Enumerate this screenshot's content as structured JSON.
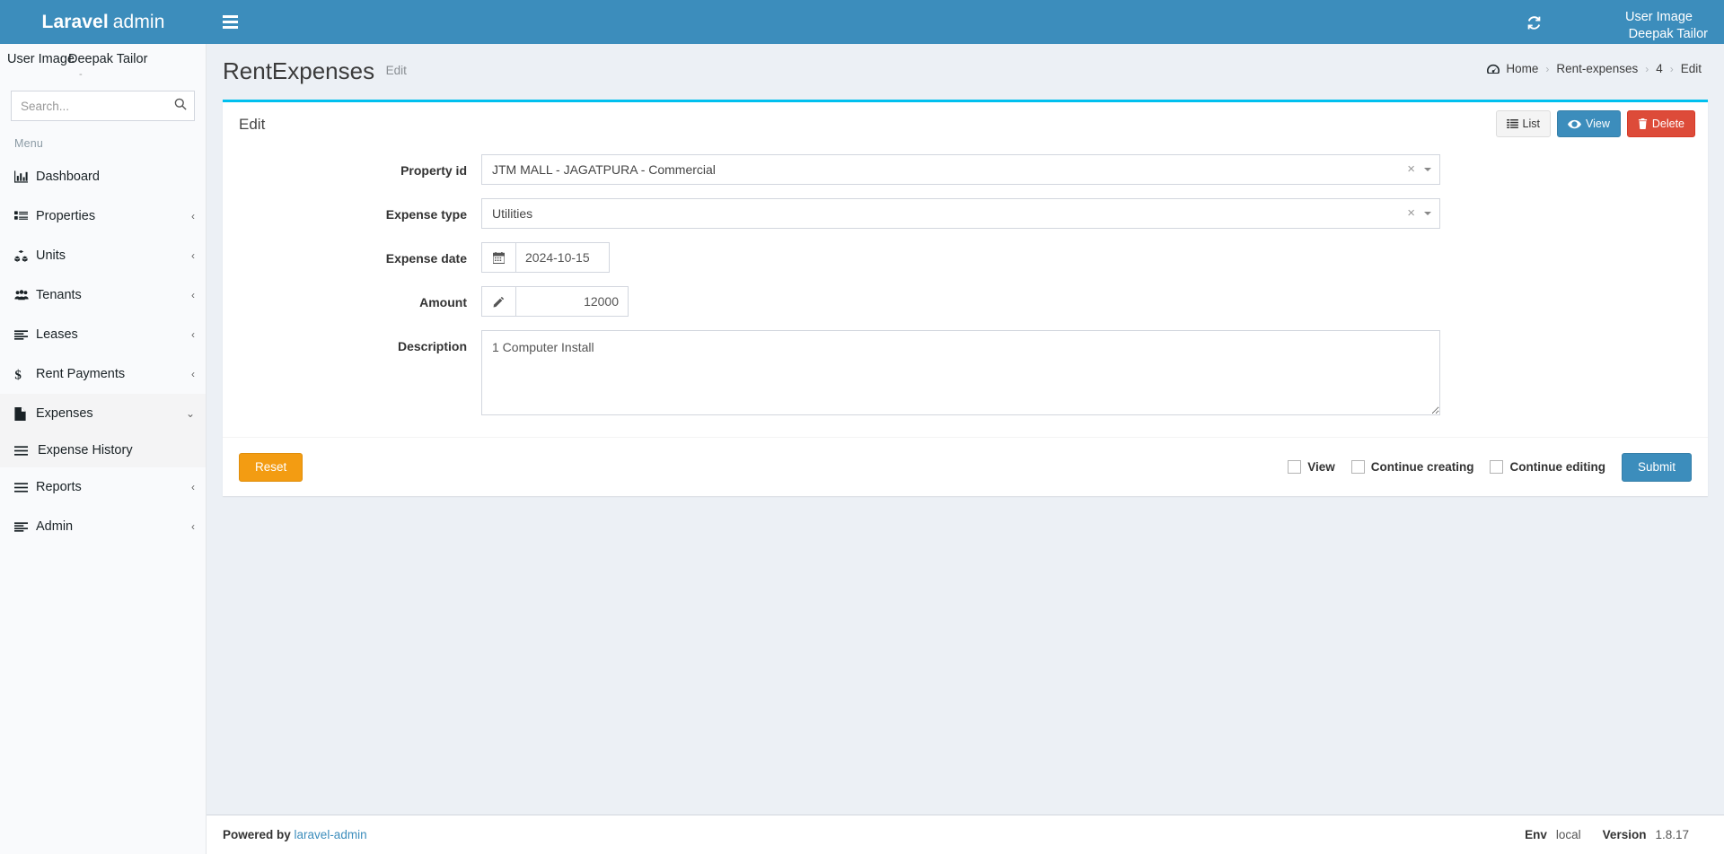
{
  "navbar": {
    "brand_bold": "Laravel",
    "brand_light": "admin",
    "toggle_icon": "hamburger-icon",
    "refresh_icon": "refresh-icon",
    "user_image_alt": "User Image",
    "user_name": "Deepak Tailor"
  },
  "sidebar": {
    "user_panel": {
      "image_alt": "User Image",
      "name": "Deepak Tailor",
      "broken_mark": "-"
    },
    "search": {
      "placeholder": "Search...",
      "value": "",
      "icon": "search-icon"
    },
    "menu_header": "Menu",
    "items": [
      {
        "label": "Dashboard",
        "icon": "bar-chart-icon",
        "caret": "",
        "active": false
      },
      {
        "label": "Properties",
        "icon": "list-ul-icon",
        "caret": "‹",
        "active": false
      },
      {
        "label": "Units",
        "icon": "cubes-icon",
        "caret": "‹",
        "active": false
      },
      {
        "label": "Tenants",
        "icon": "users-icon",
        "caret": "‹",
        "active": false
      },
      {
        "label": "Leases",
        "icon": "align-left-icon",
        "caret": "‹",
        "active": false
      },
      {
        "label": "Rent Payments",
        "icon": "dollar-icon",
        "caret": "‹",
        "active": false
      },
      {
        "label": "Expenses",
        "icon": "file-icon",
        "caret": "⌄",
        "active": true
      },
      {
        "label": "Reports",
        "icon": "bars-icon",
        "caret": "‹",
        "active": false
      },
      {
        "label": "Admin",
        "icon": "align-left-icon",
        "caret": "‹",
        "active": false
      }
    ],
    "expenses_submenu": [
      {
        "label": "Expense History",
        "icon": "bars-icon",
        "active": true
      }
    ]
  },
  "content_header": {
    "title": "RentExpenses",
    "subtitle": "Edit"
  },
  "breadcrumb": {
    "home_icon": "dashboard-icon",
    "items": [
      {
        "label": "Home",
        "link": true
      },
      {
        "label": "Rent-expenses",
        "link": true
      },
      {
        "label": "4",
        "link": true
      },
      {
        "label": "Edit",
        "link": false
      }
    ],
    "separator": "›"
  },
  "box": {
    "accent_color": "#00c0ef",
    "title": "Edit",
    "tools": [
      {
        "label": "List",
        "icon": "list-icon",
        "style": "default"
      },
      {
        "label": "View",
        "icon": "eye-icon",
        "style": "primary"
      },
      {
        "label": "Delete",
        "icon": "trash-icon",
        "style": "danger"
      }
    ]
  },
  "form": {
    "fields": [
      {
        "name": "property_id",
        "label": "Property id",
        "type": "select2",
        "value": "JTM MALL - JAGATPURA - Commercial",
        "clear_icon": "×",
        "arrow_icon": "caret-down-icon"
      },
      {
        "name": "expense_type",
        "label": "Expense type",
        "type": "select2",
        "value": "Utilities",
        "clear_icon": "×",
        "arrow_icon": "caret-down-icon"
      },
      {
        "name": "expense_date",
        "label": "Expense date",
        "type": "date",
        "value": "2024-10-15",
        "addon_icon": "calendar-icon"
      },
      {
        "name": "amount",
        "label": "Amount",
        "type": "number",
        "value": "12000",
        "addon_icon": "pencil-icon"
      },
      {
        "name": "description",
        "label": "Description",
        "type": "textarea",
        "value": "1 Computer Install"
      }
    ]
  },
  "form_footer": {
    "reset_label": "Reset",
    "submit_label": "Submit",
    "checkboxes": [
      {
        "label": "View",
        "checked": false
      },
      {
        "label": "Continue creating",
        "checked": false
      },
      {
        "label": "Continue editing",
        "checked": false
      }
    ]
  },
  "footer": {
    "powered_by": "Powered by",
    "powered_link": "laravel-admin",
    "env_label": "Env",
    "env_value": "local",
    "version_label": "Version",
    "version_value": "1.8.17"
  },
  "colors": {
    "header_blue": "#3c8dbc",
    "accent_cyan": "#00c0ef",
    "danger_red": "#dd4b39",
    "warning_orange": "#f39c12",
    "sidebar_bg": "#f9fafc",
    "content_bg": "#ecf0f5"
  }
}
